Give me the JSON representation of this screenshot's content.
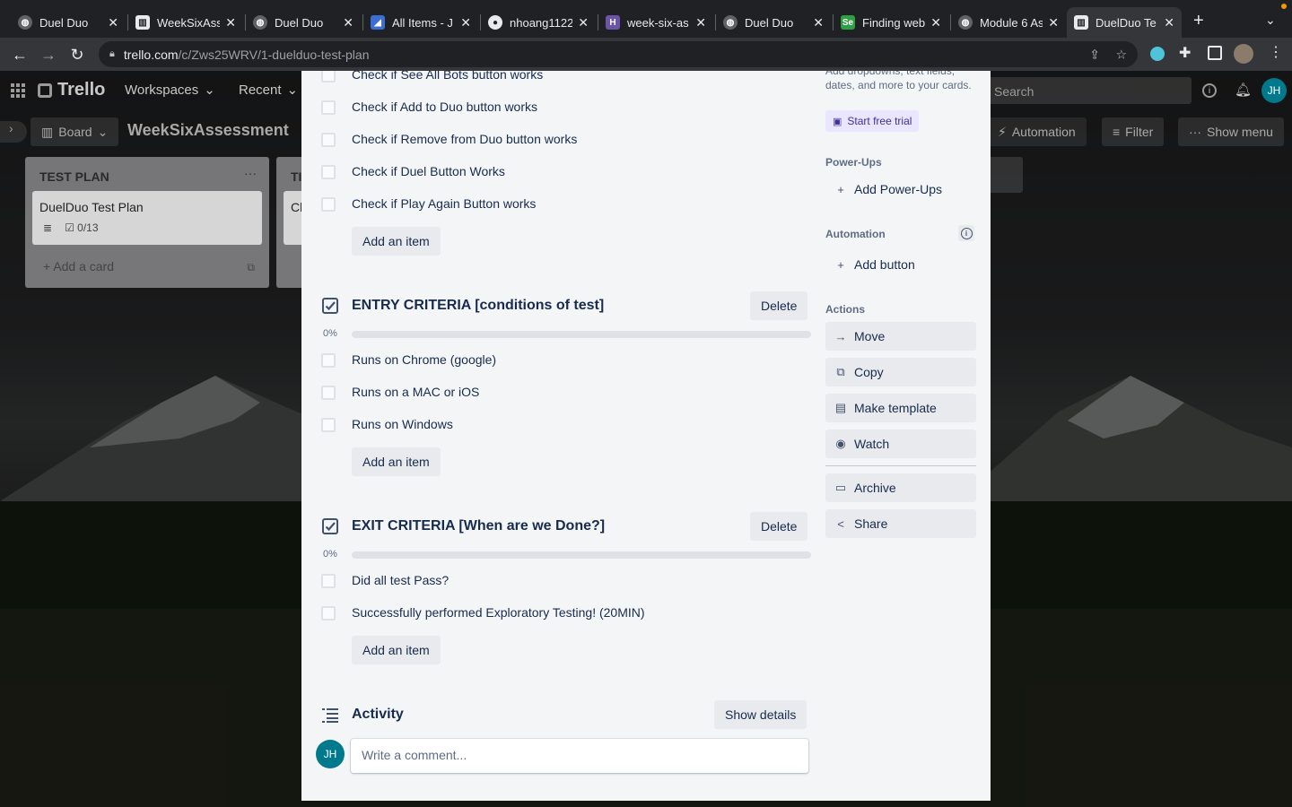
{
  "browser": {
    "tabs": [
      {
        "title": "Duel Duo",
        "icon": "globe-icon"
      },
      {
        "title": "WeekSixAss",
        "icon": "trello-icon"
      },
      {
        "title": "Duel Duo",
        "icon": "globe-icon"
      },
      {
        "title": "All Items - J",
        "icon": "azure-icon"
      },
      {
        "title": "nhoang1122",
        "icon": "github-icon"
      },
      {
        "title": "week-six-as",
        "icon": "heroku-icon"
      },
      {
        "title": "Duel Duo",
        "icon": "globe-icon"
      },
      {
        "title": "Finding web",
        "icon": "selenium-icon"
      },
      {
        "title": "Module 6 As",
        "icon": "globe-icon"
      },
      {
        "title": "DuelDuo Te",
        "icon": "trello-icon",
        "active": true
      }
    ],
    "url_host": "trello.com",
    "url_path": "/c/Zws25WRV/1-duelduo-test-plan"
  },
  "trello": {
    "logo": "Trello",
    "nav": {
      "workspaces": "Workspaces",
      "recent": "Recent"
    },
    "search_placeholder": "Search",
    "user_initials": "JH",
    "board": {
      "view": "Board",
      "title": "WeekSixAssessment",
      "automation": "Automation",
      "filter": "Filter",
      "show_menu": "Show menu"
    },
    "list": {
      "title": "TEST PLAN",
      "card_title": "DuelDuo Test Plan",
      "card_checklist": "0/13",
      "add_card": "Add a card",
      "second_list_title": "TI",
      "second_card_title": "Cl"
    }
  },
  "modal": {
    "top_items": [
      "Check if See All Bots button works",
      "Check if Add to Duo button works",
      "Check if Remove from Duo button works",
      "Check if Duel Button Works",
      "Check if Play Again Button works"
    ],
    "add_item_label": "Add an item",
    "delete_label": "Delete",
    "entry": {
      "title": "ENTRY CRITERIA [conditions of test]",
      "percent": "0%",
      "progress": 0,
      "items": [
        "Runs on Chrome (google)",
        "Runs on a MAC or iOS",
        "Runs on Windows"
      ]
    },
    "exit": {
      "title": "EXIT CRITERIA [When are we Done?]",
      "percent": "0%",
      "progress": 0,
      "items": [
        "Did all test Pass?",
        "Successfully performed Exploratory Testing! (20MIN)"
      ]
    },
    "activity": {
      "title": "Activity",
      "show_details": "Show details",
      "comment_placeholder": "Write a comment...",
      "avatar": "JH"
    },
    "sidebar": {
      "custom_fields_desc": "Add dropdowns, text fields, dates, and more to your cards.",
      "start_trial": "Start free trial",
      "powerups_label": "Power-Ups",
      "add_powerups": "Add Power-Ups",
      "automation_label": "Automation",
      "add_button": "Add button",
      "actions_label": "Actions",
      "move": "Move",
      "copy": "Copy",
      "make_template": "Make template",
      "watch": "Watch",
      "archive": "Archive",
      "share": "Share"
    }
  },
  "colors": {
    "progress": "#5ba4cf",
    "avatar": "#00798d",
    "modal_bg": "#f4f5f7"
  }
}
